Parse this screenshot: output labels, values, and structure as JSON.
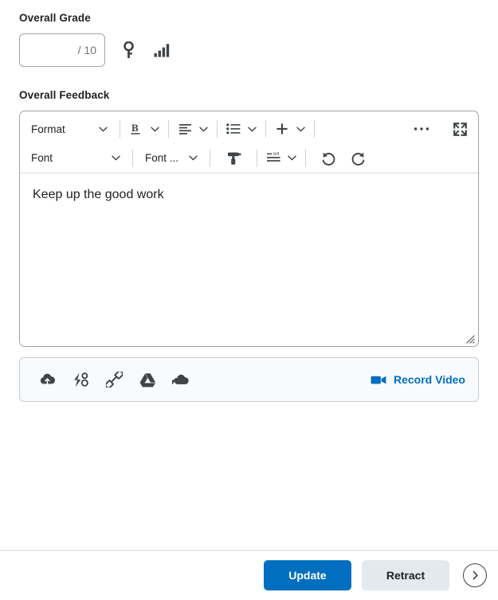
{
  "grade": {
    "label": "Overall Grade",
    "value": "",
    "placeholder": "",
    "denominator": "/ 10",
    "icons": [
      {
        "name": "rubric-key-icon",
        "title": "View Rubric"
      },
      {
        "name": "grade-statistics-icon",
        "title": "Grade Statistics"
      }
    ]
  },
  "feedback": {
    "label": "Overall Feedback",
    "body_text": "Keep up the good work",
    "toolbar": {
      "row1": {
        "format_label": "Format",
        "bold_label": "B",
        "align_label": "align-left",
        "list_label": "bullet-list",
        "insert_label": "+",
        "more_label": "more-options",
        "fullscreen_label": "fullscreen"
      },
      "row2": {
        "font_label": "Font",
        "font_size_label": "Font ...",
        "format_painter_label": "format-painter",
        "line_numbering_label": "line-numbering",
        "undo_label": "undo",
        "redo_label": "redo"
      }
    }
  },
  "attachments": {
    "buttons": [
      {
        "name": "upload-file-icon",
        "title": "Upload File"
      },
      {
        "name": "quicklink-icon",
        "title": "Insert Quicklink"
      },
      {
        "name": "insert-link-icon",
        "title": "Insert Link"
      },
      {
        "name": "google-drive-icon",
        "title": "Google Drive"
      },
      {
        "name": "onedrive-icon",
        "title": "OneDrive"
      }
    ],
    "record_video_label": "Record Video"
  },
  "footer": {
    "update_label": "Update",
    "retract_label": "Retract",
    "next_label": "next-arrow"
  },
  "colors": {
    "accent_blue": "#006fbf",
    "secondary_button": "#e3e9ef",
    "attach_bar_bg": "#f9fafe",
    "border": "#9ea4a8",
    "text": "#202122",
    "muted_text": "#6e7477"
  }
}
